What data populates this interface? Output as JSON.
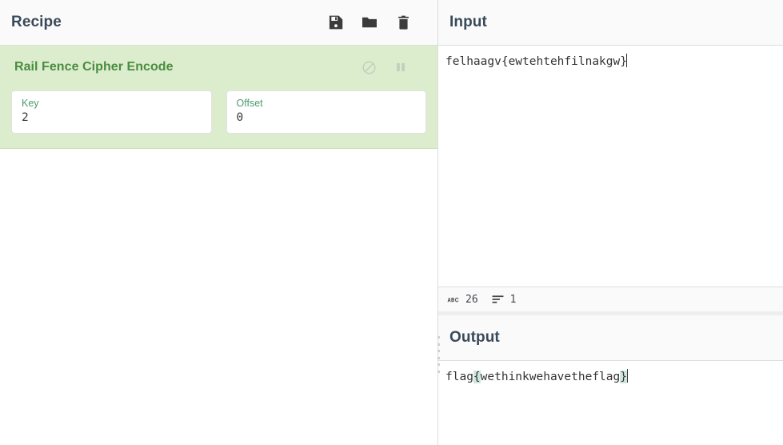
{
  "recipe": {
    "title": "Recipe",
    "controls": [
      {
        "name": "save-recipe-button",
        "icon": "floppy-disk-icon",
        "label": "Save recipe"
      },
      {
        "name": "load-recipe-button",
        "icon": "folder-icon",
        "label": "Load recipe"
      },
      {
        "name": "clear-recipe-button",
        "icon": "trash-icon",
        "label": "Clear recipe"
      }
    ],
    "operations": [
      {
        "name": "Rail Fence Cipher Encode",
        "disable_label": "Disable operation",
        "breakpoint_label": "Set breakpoint",
        "args": [
          {
            "label": "Key",
            "value": "2"
          },
          {
            "label": "Offset",
            "value": "0"
          }
        ]
      }
    ]
  },
  "input": {
    "title": "Input",
    "value": "felhaagv{ewtehtehfilnakgw}",
    "status": {
      "length_icon": "abc-icon",
      "length": "26",
      "lines_icon": "lines-icon",
      "lines": "1"
    }
  },
  "output": {
    "title": "Output",
    "prefix": "flag",
    "open_brace": "{",
    "body": "wethinkwehavetheflag",
    "close_brace": "}"
  },
  "colors": {
    "operation_bg": "#dcedcd",
    "operation_title": "#4a8c3f",
    "arg_label": "#4a9c6d",
    "header_bg": "#fafafa",
    "highlight": "#cfe5e0",
    "text": "#333333"
  }
}
